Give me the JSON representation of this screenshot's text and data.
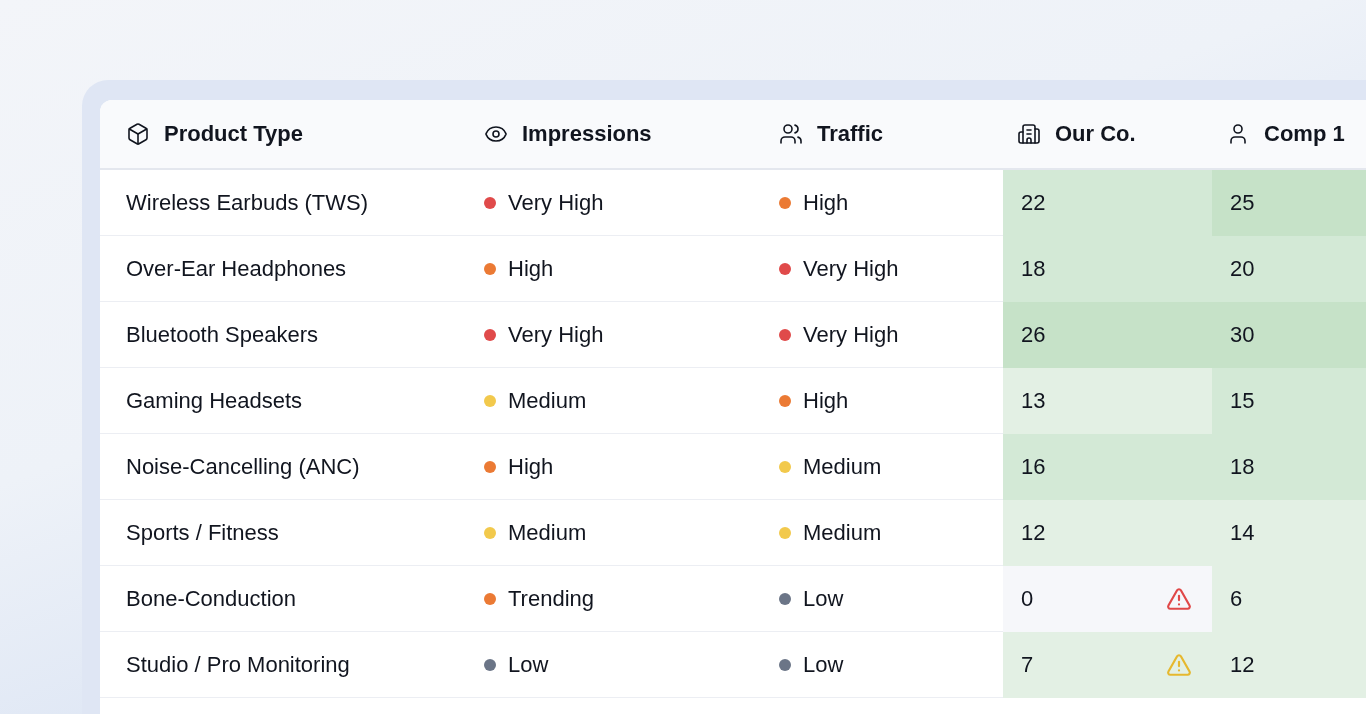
{
  "table": {
    "columns": [
      {
        "label": "Product Type"
      },
      {
        "label": "Impressions"
      },
      {
        "label": "Traffic"
      },
      {
        "label": "Our Co."
      },
      {
        "label": "Comp 1"
      }
    ],
    "rows": [
      {
        "product": "Wireless Earbuds (TWS)",
        "impressions": {
          "label": "Very High",
          "color": "#e04a4a"
        },
        "traffic": {
          "label": "High",
          "color": "#eb7a34"
        },
        "ours": {
          "value": "22",
          "color": "#d3e9d6"
        },
        "comp": {
          "value": "25",
          "color": "#c6e2c8"
        }
      },
      {
        "product": "Over-Ear Headphones",
        "impressions": {
          "label": "High",
          "color": "#eb7a34"
        },
        "traffic": {
          "label": "Very High",
          "color": "#e04a4a"
        },
        "ours": {
          "value": "18",
          "color": "#d3e9d6"
        },
        "comp": {
          "value": "20",
          "color": "#d3e9d6"
        }
      },
      {
        "product": "Bluetooth Speakers",
        "impressions": {
          "label": "Very High",
          "color": "#e04a4a"
        },
        "traffic": {
          "label": "Very High",
          "color": "#e04a4a"
        },
        "ours": {
          "value": "26",
          "color": "#c6e2c8"
        },
        "comp": {
          "value": "30",
          "color": "#c6e2c8"
        }
      },
      {
        "product": "Gaming Headsets",
        "impressions": {
          "label": "Medium",
          "color": "#f2c94c"
        },
        "traffic": {
          "label": "High",
          "color": "#eb7a34"
        },
        "ours": {
          "value": "13",
          "color": "#e3f0e4"
        },
        "comp": {
          "value": "15",
          "color": "#d3e9d6"
        }
      },
      {
        "product": "Noise-Cancelling (ANC)",
        "impressions": {
          "label": "High",
          "color": "#eb7a34"
        },
        "traffic": {
          "label": "Medium",
          "color": "#f2c94c"
        },
        "ours": {
          "value": "16",
          "color": "#d3e9d6"
        },
        "comp": {
          "value": "18",
          "color": "#d3e9d6"
        }
      },
      {
        "product": "Sports / Fitness",
        "impressions": {
          "label": "Medium",
          "color": "#f2c94c"
        },
        "traffic": {
          "label": "Medium",
          "color": "#f2c94c"
        },
        "ours": {
          "value": "12",
          "color": "#e3f0e4"
        },
        "comp": {
          "value": "14",
          "color": "#e3f0e4"
        }
      },
      {
        "product": "Bone-Conduction",
        "impressions": {
          "label": "Trending",
          "color": "#eb7a34"
        },
        "traffic": {
          "label": "Low",
          "color": "#6b7587"
        },
        "ours": {
          "value": "0",
          "color": "#f6f7fa",
          "kind": "critical"
        },
        "comp": {
          "value": "6",
          "color": "#e3f0e4"
        }
      },
      {
        "product": "Studio / Pro Monitoring",
        "impressions": {
          "label": "Low",
          "color": "#6b7587"
        },
        "traffic": {
          "label": "Low",
          "color": "#6b7587"
        },
        "ours": {
          "value": "7",
          "color": "#e3f0e4",
          "kind": "caution"
        },
        "comp": {
          "value": "12",
          "color": "#e3f0e4"
        }
      }
    ]
  }
}
